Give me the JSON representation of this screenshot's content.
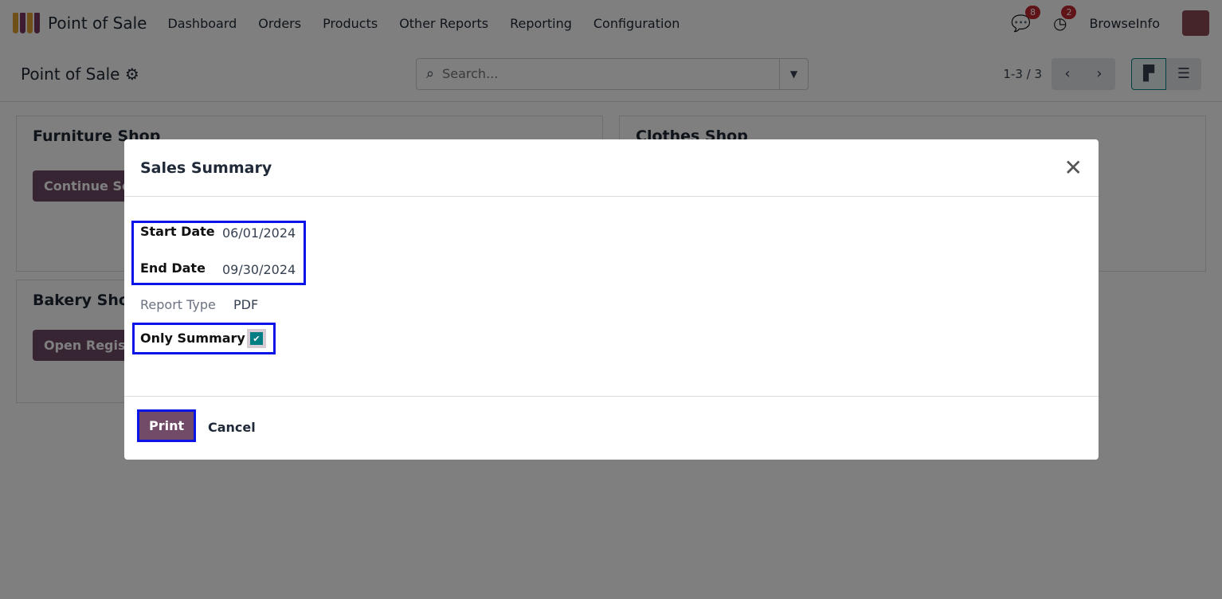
{
  "nav": {
    "app": "Point of Sale",
    "menu": [
      "Dashboard",
      "Orders",
      "Products",
      "Other Reports",
      "Reporting",
      "Configuration"
    ],
    "messages_count": "8",
    "activities_count": "2",
    "user": "BrowseInfo"
  },
  "control": {
    "title": "Point of Sale",
    "search_placeholder": "Search...",
    "pager": "1-3 / 3"
  },
  "cards": [
    {
      "name": "Furniture Shop",
      "button": "Continue Selling"
    },
    {
      "name": "Clothes Shop"
    },
    {
      "name": "Bakery Shop",
      "button": "Open Register"
    }
  ],
  "dialog": {
    "title": "Sales Summary",
    "start_label": "Start Date",
    "start_value": "06/01/2024",
    "end_label": "End Date",
    "end_value": "09/30/2024",
    "report_type_label": "Report Type",
    "report_type_value": "PDF",
    "only_summary_label": "Only Summary",
    "only_summary_checked": true,
    "print": "Print",
    "cancel": "Cancel"
  }
}
